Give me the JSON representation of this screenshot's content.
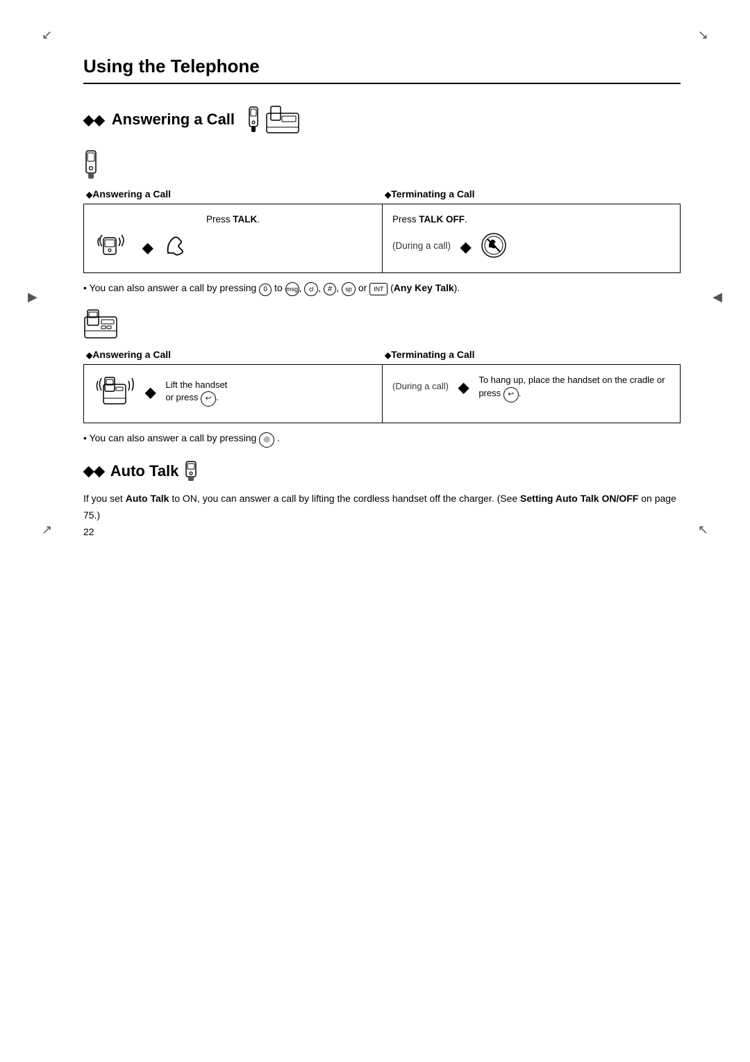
{
  "page": {
    "number": "22",
    "title": "Using the Telephone"
  },
  "sections": {
    "answering_call": {
      "title": "Answering a Call",
      "diamonds": "◆◆",
      "cordless_subsection": {
        "answering_label": "◆Answering a Call",
        "terminating_label": "◆Terminating a Call",
        "press_talk": "Press TALK.",
        "press_talk_bold": "TALK",
        "press_talk_off": "Press TALK OFF.",
        "press_talk_off_bold": "TALK OFF",
        "during_call": "(During a call)",
        "bullet_note": "You can also answer a call by pressing  to  ,  ,  ,   or   (Any Key Talk)."
      },
      "base_subsection": {
        "answering_label": "◆Answering a Call",
        "terminating_label": "◆Terminating a Call",
        "lift_handset": "Lift the handset or press",
        "hang_up": "To hang up, place the handset on the cradle or press",
        "during_call": "(During a call)",
        "bullet_note": "You can also answer a call by pressing   ."
      }
    },
    "auto_talk": {
      "title": "Auto Talk",
      "diamonds": "◆◆",
      "description": "If you set Auto Talk to ON, you can answer a call by lifting the cordless handset off the charger. (See Setting Auto Talk ON/OFF on page 75.)",
      "auto_talk_bold": "Auto Talk",
      "setting_bold": "Setting Auto Talk ON/OFF",
      "page_ref": "75"
    }
  }
}
